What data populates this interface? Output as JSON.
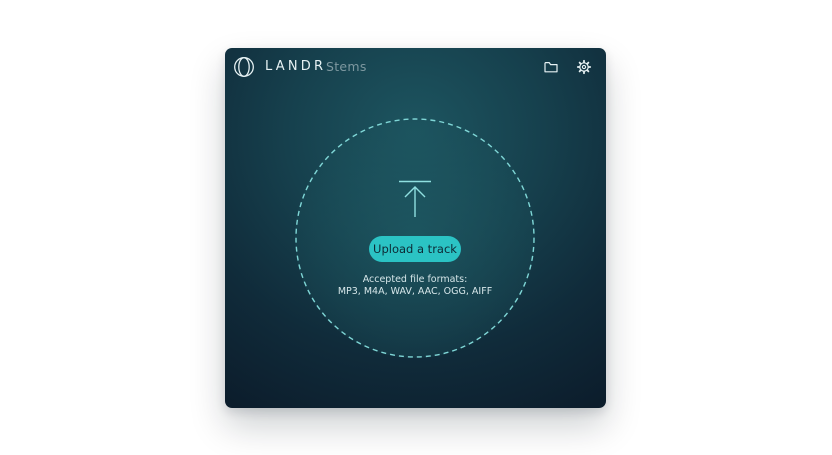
{
  "app": {
    "brand": "LANDR",
    "product": "Stems"
  },
  "header": {
    "icons": {
      "logo": "landr-logo-icon",
      "folder": "folder-icon",
      "settings": "gear-icon"
    }
  },
  "dropzone": {
    "icon": "upload-arrow-icon",
    "button_label": "Upload a track",
    "formats_label": "Accepted file formats:",
    "formats_list": "MP3, M4A, WAV, AAC, OGG, AIFF"
  },
  "colors": {
    "accent": "#2bc3c4",
    "window_bg": "#102b3a",
    "dashed_ring": "#7fd6d6"
  }
}
